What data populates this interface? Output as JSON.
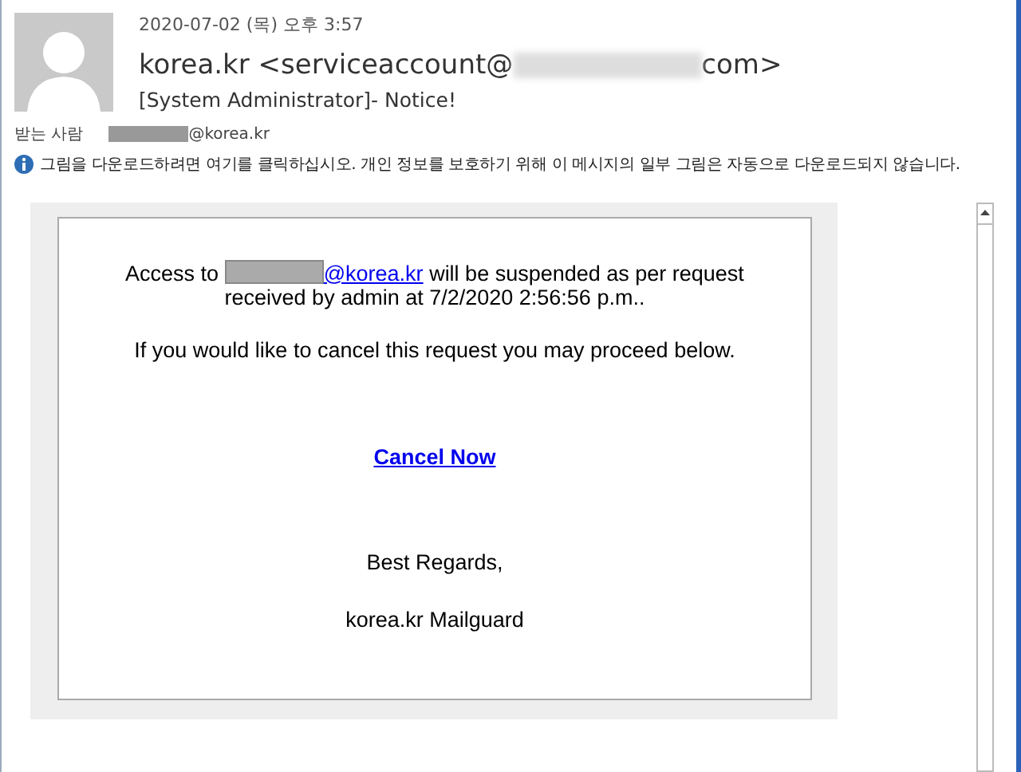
{
  "header": {
    "date": "2020-07-02 (목) 오후 3:57",
    "from_prefix": "korea.kr <serviceaccount@",
    "from_suffix": "com>",
    "subject": "[System Administrator]- Notice!",
    "to_label": "받는 사람",
    "to_suffix": "@korea.kr"
  },
  "info_bar": {
    "text": "그림을 다운로드하려면 여기를 클릭하십시오. 개인 정보를 보호하기 위해 이 메시지의 일부 그림은 자동으로 다운로드되지 않습니다."
  },
  "message": {
    "access_prefix": "Access to",
    "access_link": "@korea.kr",
    "access_rest": "will be suspended as per request",
    "access_line2": "received by admin  at 7/2/2020 2:56:56 p.m..",
    "cancel_text": "If you would like to cancel this request you may proceed below.",
    "cancel_link": "Cancel Now",
    "regards": "Best  Regards,",
    "signature": "korea.kr  Mailguard"
  }
}
